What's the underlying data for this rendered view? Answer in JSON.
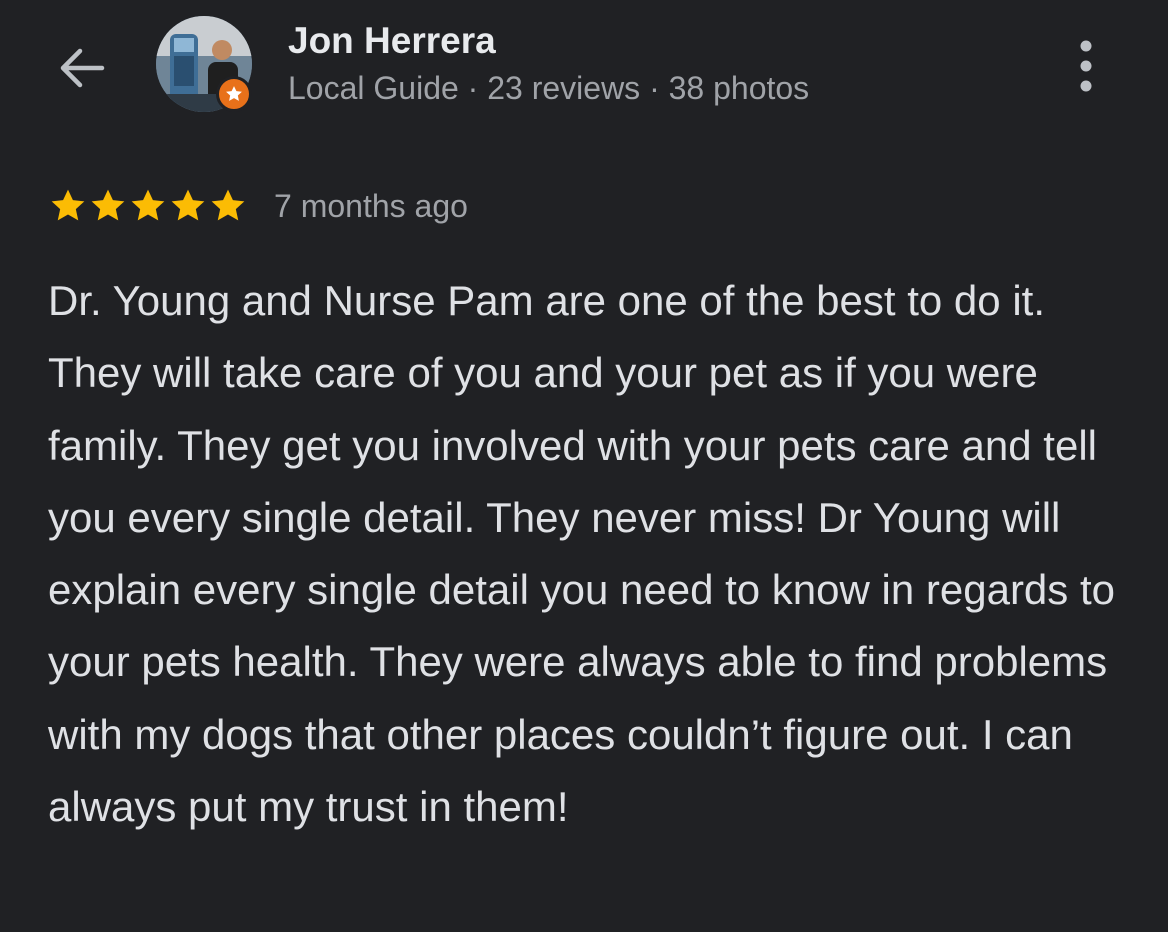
{
  "header": {
    "back_icon": "arrow-left-icon",
    "reviewer_name": "Jon Herrera",
    "reviewer_meta": "Local Guide · 23 reviews · 38 photos",
    "badge_icon": "local-guide-star-icon",
    "more_icon": "more-vertical-icon"
  },
  "review": {
    "rating": 5,
    "rating_max": 5,
    "star_color": "#fbbc04",
    "time_ago": "7 months ago",
    "text": "Dr. Young and Nurse Pam are one of the best to do it. They will take care of you and your pet as if you were family. They get you involved with your pets care and tell you every single detail. They never miss! Dr Young will explain every single detail you need to know in regards to your pets health. They were always able to find problems with my dogs that other places couldn’t figure out. I can always put my trust in them!"
  },
  "colors": {
    "background": "#202124",
    "primary_text": "#e8eaed",
    "secondary_text": "#a0a3a8",
    "badge": "#e8711a"
  }
}
